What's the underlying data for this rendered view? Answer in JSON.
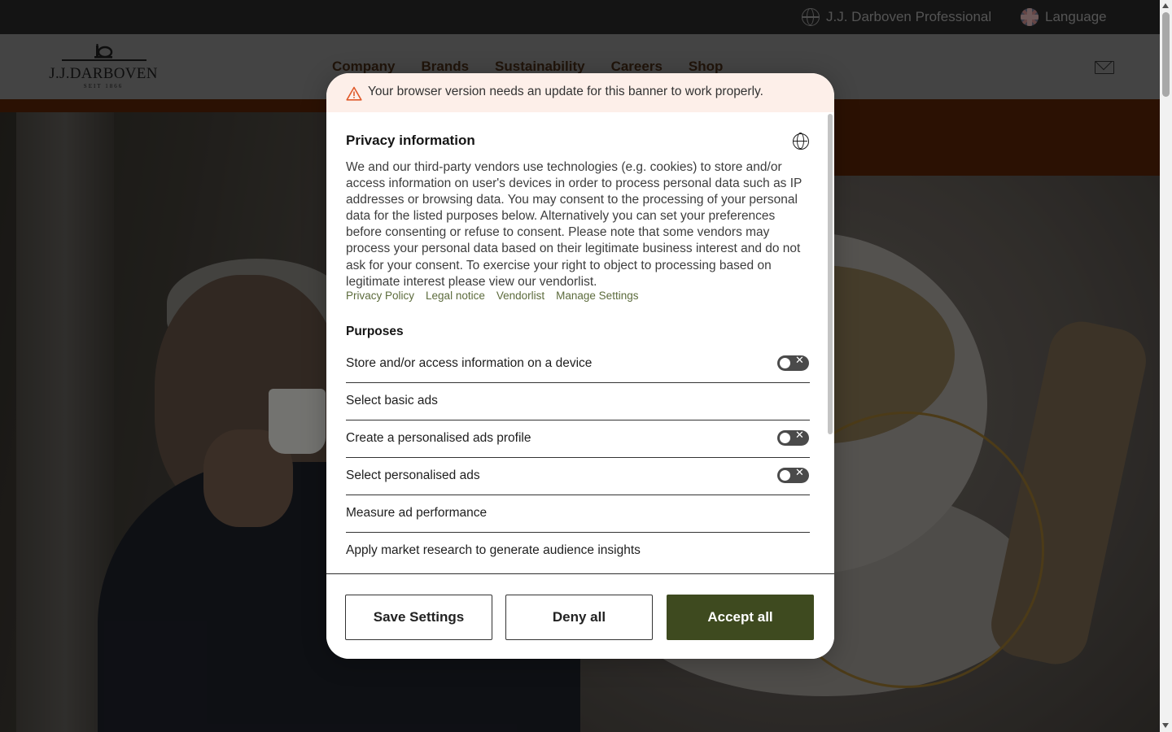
{
  "topbar": {
    "professional": "J.J. Darboven Professional",
    "language": "Language"
  },
  "logo": {
    "name": "J.J.DARBOVEN",
    "since": "SEIT 1866"
  },
  "nav": {
    "items": [
      "Company",
      "Brands",
      "Sustainability",
      "Careers",
      "Shop"
    ]
  },
  "consent": {
    "warning": "Your browser version needs an update for this banner to work properly.",
    "title": "Privacy information",
    "description": "We and our third-party vendors use technologies (e.g. cookies) to store and/or access information on user's devices in order to process personal data such as IP addresses or browsing data. You may consent to the processing of your personal data for the listed purposes below. Alternatively you can set your preferences before consenting or refuse to consent. Please note that some vendors may process your personal data based on their legitimate business interest and do not ask for your consent. To exercise your right to object to processing based on legitimate interest please view our vendorlist.",
    "links": [
      "Privacy Policy",
      "Legal notice",
      "Vendorlist",
      "Manage Settings"
    ],
    "purposes_heading": "Purposes",
    "purposes": [
      {
        "label": "Store and/or access information on a device",
        "toggle": true,
        "enabled": false
      },
      {
        "label": "Select basic ads",
        "toggle": false
      },
      {
        "label": "Create a personalised ads profile",
        "toggle": true,
        "enabled": false
      },
      {
        "label": "Select personalised ads",
        "toggle": true,
        "enabled": false
      },
      {
        "label": "Measure ad performance",
        "toggle": false
      },
      {
        "label": "Apply market research to generate audience insights",
        "toggle": false
      }
    ],
    "buttons": {
      "save": "Save Settings",
      "deny": "Deny all",
      "accept": "Accept all"
    },
    "colors": {
      "accent": "#3e4a1f",
      "link": "#5c6b3c",
      "warning_bg": "#fdefe9"
    }
  }
}
